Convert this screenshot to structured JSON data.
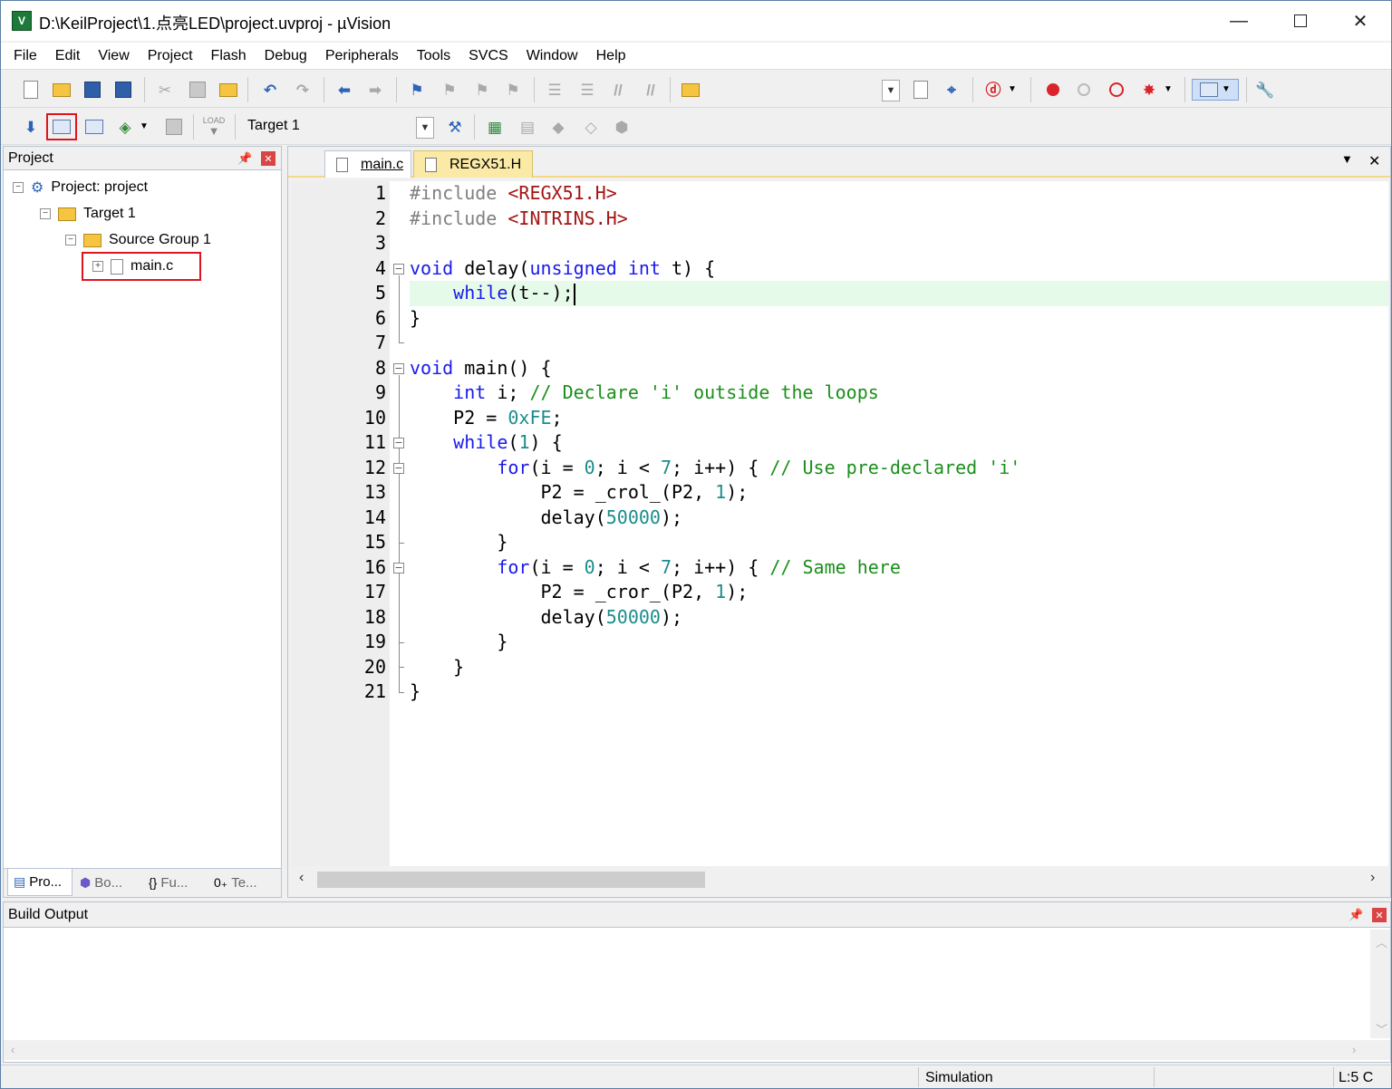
{
  "window": {
    "title": "D:\\KeilProject\\1.点亮LED\\project.uvproj - µVision"
  },
  "menu": [
    "File",
    "Edit",
    "View",
    "Project",
    "Flash",
    "Debug",
    "Peripherals",
    "Tools",
    "SVCS",
    "Window",
    "Help"
  ],
  "toolbar2": {
    "target": "Target 1",
    "load_text": "LOAD"
  },
  "project_panel": {
    "title": "Project",
    "tree": {
      "project": "Project: project",
      "target": "Target 1",
      "group": "Source Group 1",
      "file": "main.c"
    },
    "tabs": [
      "Pro...",
      "Bo...",
      "Fu...",
      "Te..."
    ]
  },
  "editor": {
    "tabs": [
      "main.c",
      "REGX51.H"
    ],
    "active_tab": "main.c",
    "current_line": 5,
    "line_numbers": [
      "1",
      "2",
      "3",
      "4",
      "5",
      "6",
      "7",
      "8",
      "9",
      "10",
      "11",
      "12",
      "13",
      "14",
      "15",
      "16",
      "17",
      "18",
      "19",
      "20",
      "21"
    ]
  },
  "build_output": {
    "title": "Build Output"
  },
  "status": {
    "mode": "Simulation",
    "position": "L:5 C"
  },
  "colors": {
    "keyword": "#1a1aeb",
    "comment": "#1a8f1a",
    "number": "#1c8c8c",
    "preprocessor": "#7f7f7f",
    "include_file": "#a31515",
    "current_line_bg": "#e5fae8",
    "highlight_box": "#e0141e"
  }
}
